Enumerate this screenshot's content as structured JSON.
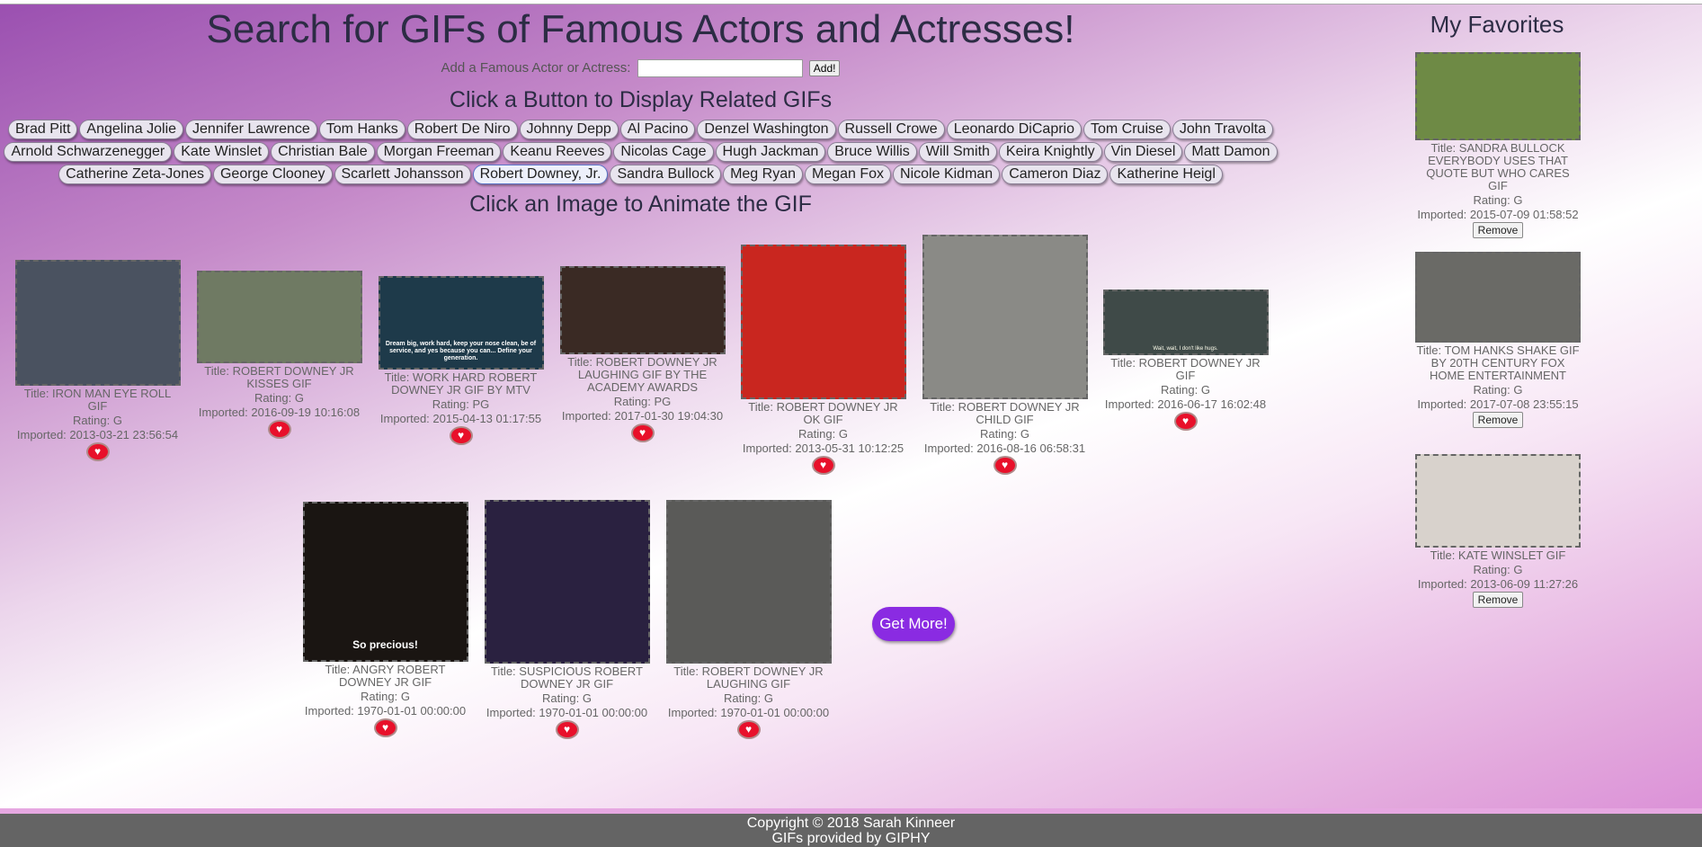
{
  "header": {
    "title": "Search for GIFs of Famous Actors and Actresses!",
    "add_label": "Add a Famous Actor or Actress:",
    "add_input_value": "",
    "add_button": "Add!",
    "buttons_heading": "Click a Button to Display Related GIFs",
    "images_heading": "Click an Image to Animate the GIF"
  },
  "actor_buttons_row1": [
    "Brad Pitt",
    "Angelina Jolie",
    "Jennifer Lawrence",
    "Tom Hanks",
    "Robert De Niro",
    "Johnny Depp",
    "Al Pacino",
    "Denzel Washington",
    "Russell Crowe",
    "Leonardo DiCaprio",
    "Tom Cruise",
    "John Travolta"
  ],
  "actor_buttons_row2": [
    "Arnold Schwarzenegger",
    "Kate Winslet",
    "Christian Bale",
    "Morgan Freeman",
    "Keanu Reeves",
    "Nicolas Cage",
    "Hugh Jackman",
    "Bruce Willis",
    "Will Smith",
    "Keira Knightly",
    "Vin Diesel",
    "Matt Damon"
  ],
  "actor_buttons_row3": [
    "Catherine Zeta-Jones",
    "George Clooney",
    "Scarlett Johansson",
    "Robert Downey, Jr.",
    "Sandra Bullock",
    "Meg Ryan",
    "Megan Fox",
    "Nicole Kidman",
    "Cameron Diaz",
    "Katherine Heigl"
  ],
  "selected_actor": "Robert Downey, Jr.",
  "gifs": [
    {
      "title": "Title: IRON MAN EYE ROLL GIF",
      "rating": "Rating: G",
      "imported": "Imported: 2013-03-21 23:56:54",
      "bg": "#4a5260"
    },
    {
      "title": "Title: ROBERT DOWNEY JR KISSES GIF",
      "rating": "Rating: G",
      "imported": "Imported: 2016-09-19 10:16:08",
      "bg": "#6f7a63"
    },
    {
      "title": "Title: WORK HARD ROBERT DOWNEY JR GIF BY MTV",
      "rating": "Rating: PG",
      "imported": "Imported: 2015-04-13 01:17:55",
      "bg": "#1e3a4a",
      "caption": "Dream big, work hard, keep your nose clean, be of service, and yes because you can... Define your generation."
    },
    {
      "title": "Title: ROBERT DOWNEY JR LAUGHING GIF BY THE ACADEMY AWARDS",
      "rating": "Rating: PG",
      "imported": "Imported: 2017-01-30 19:04:30",
      "bg": "#3a2a24"
    },
    {
      "title": "Title: ROBERT DOWNEY JR OK GIF",
      "rating": "Rating: G",
      "imported": "Imported: 2013-05-31 10:12:25",
      "bg": "#c9261f"
    },
    {
      "title": "Title: ROBERT DOWNEY JR CHILD GIF",
      "rating": "Rating: G",
      "imported": "Imported: 2016-08-16 06:58:31",
      "bg": "#8a8a86"
    },
    {
      "title": "Title: ROBERT DOWNEY JR GIF",
      "rating": "Rating: G",
      "imported": "Imported: 2016-06-17 16:02:48",
      "bg": "#3f4a48",
      "caption": "Wait, wait, I don't like hugs."
    },
    {
      "title": "Title: ANGRY ROBERT DOWNEY JR GIF",
      "rating": "Rating: G",
      "imported": "Imported: 1970-01-01 00:00:00",
      "bg": "#1a1512",
      "caption": "So precious!"
    },
    {
      "title": "Title: SUSPICIOUS ROBERT DOWNEY JR GIF",
      "rating": "Rating: G",
      "imported": "Imported: 1970-01-01 00:00:00",
      "bg": "#2a2140"
    },
    {
      "title": "Title: ROBERT DOWNEY JR LAUGHING GIF",
      "rating": "Rating: G",
      "imported": "Imported: 1970-01-01 00:00:00",
      "bg": "#5a5a58"
    }
  ],
  "get_more": "Get More!",
  "favorites": {
    "heading": "My Favorites",
    "items": [
      {
        "title": "Title: SANDRA BULLOCK EVERYBODY USES THAT QUOTE BUT WHO CARES GIF",
        "rating": "Rating: G",
        "imported": "Imported: 2015-07-09 01:58:52",
        "remove": "Remove",
        "bg": "#6e8a45"
      },
      {
        "title": "Title: TOM HANKS SHAKE GIF BY 20TH CENTURY FOX HOME ENTERTAINMENT",
        "rating": "Rating: G",
        "imported": "Imported: 2017-07-08 23:55:15",
        "remove": "Remove",
        "bg": "#6a6a66"
      },
      {
        "title": "Title: KATE WINSLET GIF",
        "rating": "Rating: G",
        "imported": "Imported: 2013-06-09 11:27:26",
        "remove": "Remove",
        "bg": "#d8d2cc"
      }
    ]
  },
  "footer": {
    "line1": "Copyright © 2018 Sarah Kinneer",
    "line2": "GIFs provided by GIPHY"
  },
  "icons": {
    "favorite": "heart-icon"
  }
}
